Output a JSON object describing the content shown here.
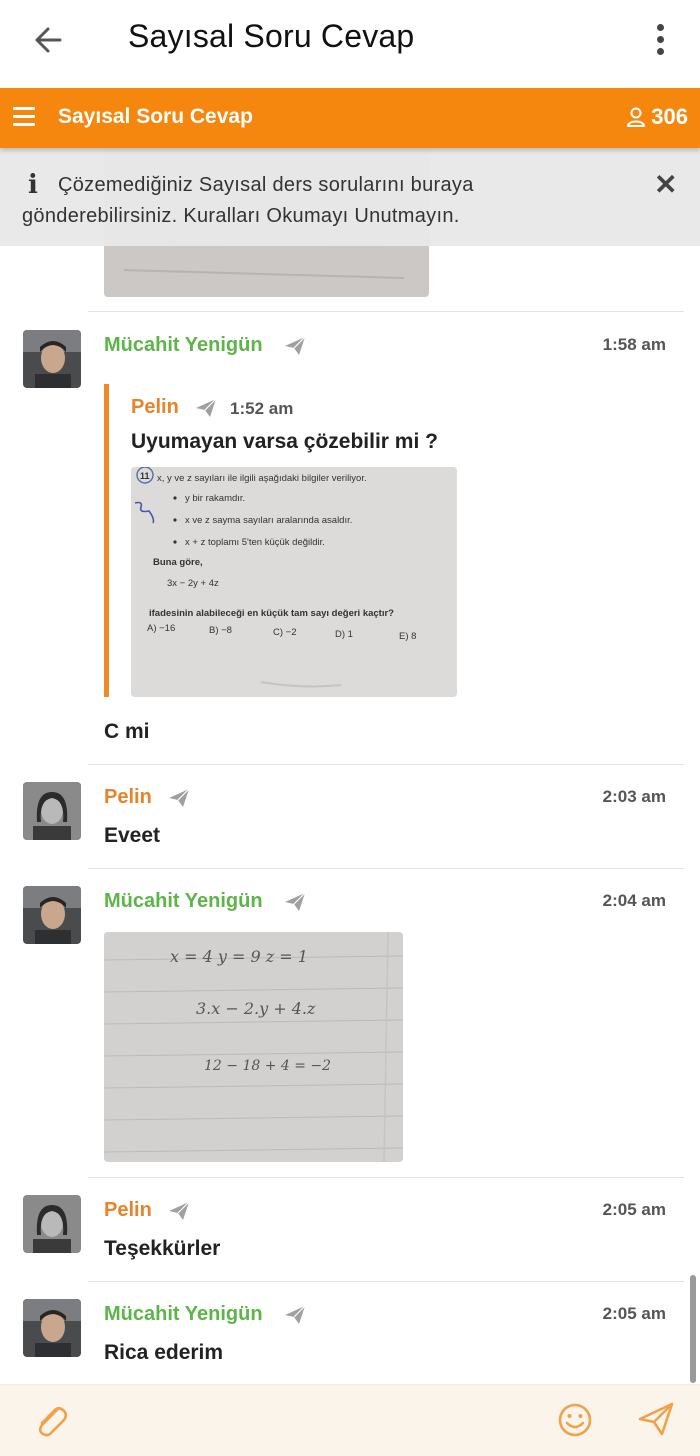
{
  "header": {
    "title": "Sayısal Soru Cevap"
  },
  "channel": {
    "name": "Sayısal Soru Cevap",
    "member_count": "306"
  },
  "notice": {
    "text": "Çözemediğiniz Sayısal ders sorularını buraya gönderebilirsiniz. Kuralları Okumayı Unutmayın."
  },
  "messages": [
    {
      "sender": "Mücahit Yenigün",
      "time": "1:58 am",
      "reply_to": {
        "sender": "Pelin",
        "time": "1:52 am",
        "text": "Uyumayan varsa çözebilir mi ?",
        "image_text": {
          "q_number": "11",
          "intro": "x, y ve z sayıları ile ilgili aşağıdaki bilgiler veriliyor.",
          "b1": "y bir rakamdır.",
          "b2": "x ve z sayma sayıları aralarında asaldır.",
          "b3": "x + z toplamı 5'ten küçük değildir.",
          "buna": "Buna göre,",
          "expr": "3x − 2y + 4z",
          "question": "ifadesinin alabileceği en küçük tam sayı değeri kaçtır?",
          "choices": [
            "A) −16",
            "B) −8",
            "C) −2",
            "D) 1",
            "E) 8"
          ]
        }
      },
      "text": "C mi"
    },
    {
      "sender": "Pelin",
      "time": "2:03 am",
      "text": "Eveet"
    },
    {
      "sender": "Mücahit Yenigün",
      "time": "2:04 am",
      "image_text": {
        "line1": "x = 4    y = 9    z = 1",
        "line2": "3.x − 2.y + 4.z",
        "line3": "12 − 18 + 4 = −2"
      }
    },
    {
      "sender": "Pelin",
      "time": "2:05 am",
      "text": "Teşekkürler"
    },
    {
      "sender": "Mücahit Yenigün",
      "time": "2:05 am",
      "text": "Rica ederim"
    }
  ],
  "colors": {
    "accent": "#f5870f",
    "sender_green": "#5db54a",
    "sender_orange": "#e8832b"
  },
  "icons": [
    "back-arrow-icon",
    "more-vert-icon",
    "menu-icon",
    "person-icon",
    "info-icon",
    "close-icon",
    "send-icon",
    "attach-icon",
    "emoji-icon"
  ]
}
